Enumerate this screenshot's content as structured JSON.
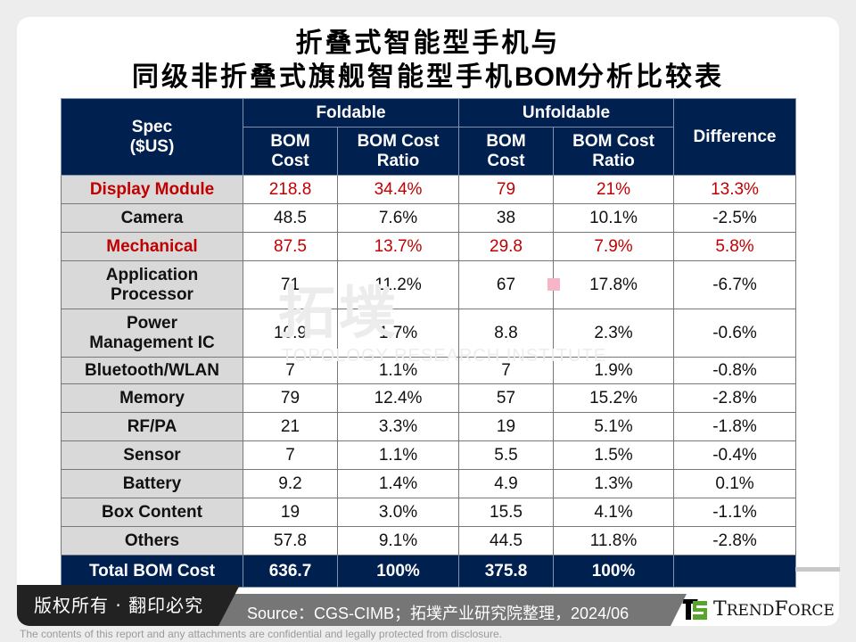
{
  "title": {
    "line1": "折叠式智能型手机与",
    "line2_pre": "同级非折叠式旗舰智能型手机",
    "line2_bom": "BOM",
    "line2_post": "分析比较表"
  },
  "watermark": {
    "cn": "拓墣",
    "en": "TOPOLOGY RESEARCH INSTITUTE"
  },
  "table": {
    "headers": {
      "spec": "Spec",
      "spec_unit": "($US)",
      "foldable": "Foldable",
      "unfoldable": "Unfoldable",
      "difference": "Difference",
      "bom_cost_1": "BOM",
      "bom_cost_2": "Cost",
      "ratio_1": "BOM Cost",
      "ratio_2": "Ratio"
    },
    "rows": [
      {
        "spec": "Display Module",
        "spec2": "",
        "f_cost": "218.8",
        "f_ratio": "34.4%",
        "u_cost": "79",
        "u_ratio": "21%",
        "diff": "13.3%",
        "highlight": true
      },
      {
        "spec": "Camera",
        "spec2": "",
        "f_cost": "48.5",
        "f_ratio": "7.6%",
        "u_cost": "38",
        "u_ratio": "10.1%",
        "diff": "-2.5%",
        "highlight": false
      },
      {
        "spec": "Mechanical",
        "spec2": "",
        "f_cost": "87.5",
        "f_ratio": "13.7%",
        "u_cost": "29.8",
        "u_ratio": "7.9%",
        "diff": "5.8%",
        "highlight": true
      },
      {
        "spec": "Application",
        "spec2": "Processor",
        "f_cost": "71",
        "f_ratio": "11.2%",
        "u_cost": "67",
        "u_ratio": "17.8%",
        "diff": "-6.7%",
        "highlight": false
      },
      {
        "spec": "Power",
        "spec2": "Management IC",
        "f_cost": "10.9",
        "f_ratio": "1.7%",
        "u_cost": "8.8",
        "u_ratio": "2.3%",
        "diff": "-0.6%",
        "highlight": false
      },
      {
        "spec": "Bluetooth/WLAN",
        "spec2": "",
        "f_cost": "7",
        "f_ratio": "1.1%",
        "u_cost": "7",
        "u_ratio": "1.9%",
        "diff": "-0.8%",
        "highlight": false
      },
      {
        "spec": "Memory",
        "spec2": "",
        "f_cost": "79",
        "f_ratio": "12.4%",
        "u_cost": "57",
        "u_ratio": "15.2%",
        "diff": "-2.8%",
        "highlight": false
      },
      {
        "spec": "RF/PA",
        "spec2": "",
        "f_cost": "21",
        "f_ratio": "3.3%",
        "u_cost": "19",
        "u_ratio": "5.1%",
        "diff": "-1.8%",
        "highlight": false
      },
      {
        "spec": "Sensor",
        "spec2": "",
        "f_cost": "7",
        "f_ratio": "1.1%",
        "u_cost": "5.5",
        "u_ratio": "1.5%",
        "diff": "-0.4%",
        "highlight": false
      },
      {
        "spec": "Battery",
        "spec2": "",
        "f_cost": "9.2",
        "f_ratio": "1.4%",
        "u_cost": "4.9",
        "u_ratio": "1.3%",
        "diff": "0.1%",
        "highlight": false
      },
      {
        "spec": "Box Content",
        "spec2": "",
        "f_cost": "19",
        "f_ratio": "3.0%",
        "u_cost": "15.5",
        "u_ratio": "4.1%",
        "diff": "-1.1%",
        "highlight": false
      },
      {
        "spec": "Others",
        "spec2": "",
        "f_cost": "57.8",
        "f_ratio": "9.1%",
        "u_cost": "44.5",
        "u_ratio": "11.8%",
        "diff": "-2.8%",
        "highlight": false
      }
    ],
    "total": {
      "spec": "Total BOM Cost",
      "f_cost": "636.7",
      "f_ratio": "100%",
      "u_cost": "375.8",
      "u_ratio": "100%",
      "diff": ""
    }
  },
  "footer": {
    "copyright": "版权所有 · 翻印必究",
    "source": "Source：CGS-CIMB；拓墣产业研究院整理，2024/06",
    "logo_text_big_t": "T",
    "logo_text_rend": "REND",
    "logo_text_big_f": "F",
    "logo_text_orce": "ORCE",
    "disclaimer": "The contents of this report and any attachments are confidential and legally protected from disclosure."
  },
  "colors": {
    "header_bg": "#002050",
    "highlight_text": "#c00000",
    "spec_bg": "#d9d9d9",
    "logo_green": "#57a52b"
  }
}
